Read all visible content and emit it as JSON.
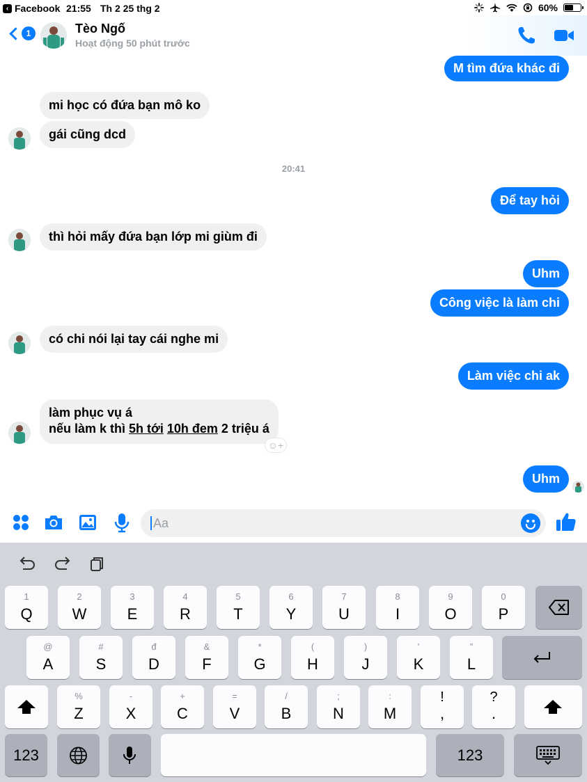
{
  "status_bar": {
    "back_app": "Facebook",
    "time": "21:55",
    "date": "Th 2 25 thg 2",
    "battery": "60%",
    "battery_level": 0.6
  },
  "header": {
    "unread_badge": "1",
    "contact_name": "Tèo Ngố",
    "contact_status": "Hoạt động 50 phút trước",
    "accent_color": "#0a7cff"
  },
  "messages": {
    "m1": "M tìm đứa khác đi",
    "m2": "mi học có đứa bạn mô ko",
    "m3": "gái cũng dcd",
    "timestamp": "20:41",
    "m4": "Để tay hỏi",
    "m5": "thì hỏi mấy đứa bạn lớp mi giùm đi",
    "m6": "Uhm",
    "m7": "Công việc là làm chi",
    "m8": "có chi nói lại tay cái nghe mi",
    "m9": "Làm việc chi ak",
    "m10_line1": "làm phục vụ á",
    "m10_line2_a": "nếu làm k thì ",
    "m10_line2_b": "5h tới",
    "m10_line2_c": " ",
    "m10_line2_d": "10h đem",
    "m10_line2_e": " 2 triệu á",
    "m11": "Uhm"
  },
  "composer": {
    "placeholder": "Aa"
  },
  "keyboard": {
    "row1": [
      {
        "hint": "1",
        "key": "Q"
      },
      {
        "hint": "2",
        "key": "W"
      },
      {
        "hint": "3",
        "key": "E"
      },
      {
        "hint": "4",
        "key": "R"
      },
      {
        "hint": "5",
        "key": "T"
      },
      {
        "hint": "6",
        "key": "Y"
      },
      {
        "hint": "7",
        "key": "U"
      },
      {
        "hint": "8",
        "key": "I"
      },
      {
        "hint": "9",
        "key": "O"
      },
      {
        "hint": "0",
        "key": "P"
      }
    ],
    "row2": [
      {
        "hint": "@",
        "key": "A"
      },
      {
        "hint": "#",
        "key": "S"
      },
      {
        "hint": "đ",
        "key": "D"
      },
      {
        "hint": "&",
        "key": "F"
      },
      {
        "hint": "*",
        "key": "G"
      },
      {
        "hint": "(",
        "key": "H"
      },
      {
        "hint": ")",
        "key": "J"
      },
      {
        "hint": "’",
        "key": "K"
      },
      {
        "hint": "”",
        "key": "L"
      }
    ],
    "row3": [
      {
        "hint": "%",
        "key": "Z"
      },
      {
        "hint": "-",
        "key": "X"
      },
      {
        "hint": "+",
        "key": "C"
      },
      {
        "hint": "=",
        "key": "V"
      },
      {
        "hint": "/",
        "key": "B"
      },
      {
        "hint": ";",
        "key": "N"
      },
      {
        "hint": ":",
        "key": "M"
      },
      {
        "hint": "!",
        "key": ","
      },
      {
        "hint": "?",
        "key": "."
      }
    ],
    "numbers_left": "123",
    "numbers_right": "123"
  }
}
